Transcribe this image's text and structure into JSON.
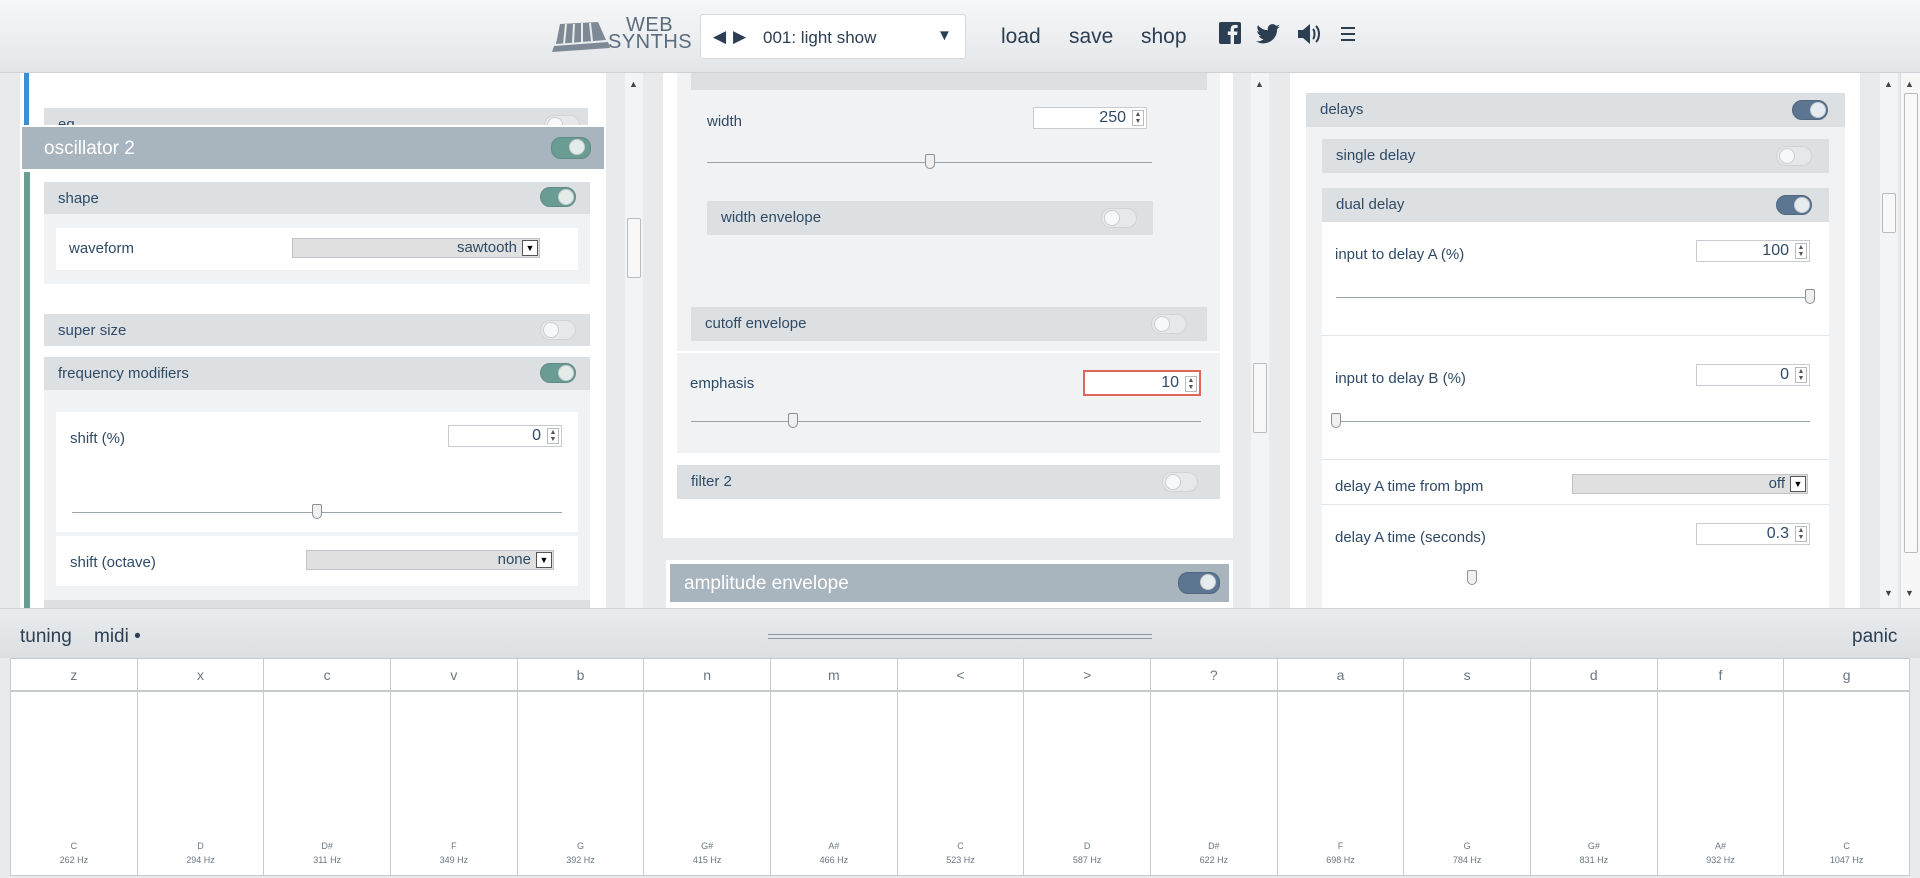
{
  "header": {
    "logo_line1": "WEB",
    "logo_line2": "SYNTHS",
    "preset_name": "001: light show",
    "nav": [
      "load",
      "save",
      "shop"
    ],
    "icons": [
      "facebook-icon",
      "twitter-icon",
      "speaker-icon",
      "menu-icon"
    ]
  },
  "left": {
    "eq_label": "eq",
    "osc2_title": "oscillator 2",
    "shape_label": "shape",
    "waveform_label": "waveform",
    "waveform_value": "sawtooth",
    "super_size_label": "super size",
    "freq_mod_label": "frequency modifiers",
    "shift_pct_label": "shift (%)",
    "shift_pct_value": "0",
    "shift_pct_level": 0.5,
    "shift_oct_label": "shift (octave)",
    "shift_oct_value": "none"
  },
  "middle": {
    "width_label": "width",
    "width_value": "250",
    "width_level": 0.5,
    "width_env_label": "width envelope",
    "cutoff_env_label": "cutoff envelope",
    "emphasis_label": "emphasis",
    "emphasis_value": "10",
    "emphasis_level": 0.2,
    "filter2_label": "filter 2",
    "amp_env_title": "amplitude envelope"
  },
  "right": {
    "delays_label": "delays",
    "single_delay_label": "single delay",
    "dual_delay_label": "dual delay",
    "input_a_label": "input to delay A (%)",
    "input_a_value": "100",
    "input_a_level": 1.0,
    "input_b_label": "input to delay B (%)",
    "input_b_value": "0",
    "input_b_level": 0.0,
    "bpm_label": "delay A time from bpm",
    "bpm_value": "off",
    "time_label": "delay A time (seconds)",
    "time_value": "0.3"
  },
  "keyboard_bar": {
    "tuning": "tuning",
    "midi": "midi •",
    "panic": "panic"
  },
  "keys": [
    {
      "key": "z",
      "note": "C",
      "hz": "262 Hz"
    },
    {
      "key": "x",
      "note": "D",
      "hz": "294 Hz"
    },
    {
      "key": "c",
      "note": "D#",
      "hz": "311 Hz"
    },
    {
      "key": "v",
      "note": "F",
      "hz": "349 Hz"
    },
    {
      "key": "b",
      "note": "G",
      "hz": "392 Hz"
    },
    {
      "key": "n",
      "note": "G#",
      "hz": "415 Hz"
    },
    {
      "key": "m",
      "note": "A#",
      "hz": "466 Hz"
    },
    {
      "key": "<",
      "note": "C",
      "hz": "523 Hz"
    },
    {
      "key": ">",
      "note": "D",
      "hz": "587 Hz"
    },
    {
      "key": "?",
      "note": "D#",
      "hz": "622 Hz"
    },
    {
      "key": "a",
      "note": "F",
      "hz": "698 Hz"
    },
    {
      "key": "s",
      "note": "G",
      "hz": "784 Hz"
    },
    {
      "key": "d",
      "note": "G#",
      "hz": "831 Hz"
    },
    {
      "key": "f",
      "note": "A#",
      "hz": "932 Hz"
    },
    {
      "key": "g",
      "note": "C",
      "hz": "1047 Hz"
    }
  ],
  "colors": {
    "accent_teal": "#6b9c93",
    "accent_blue": "#5c7591",
    "text": "#2e4a65"
  }
}
